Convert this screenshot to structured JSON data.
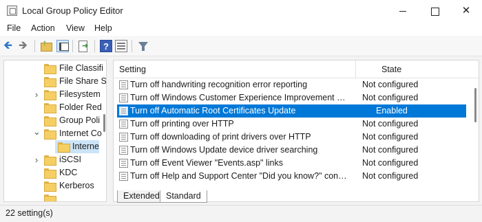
{
  "window": {
    "title": "Local Group Policy Editor"
  },
  "menu": [
    "File",
    "Action",
    "View",
    "Help"
  ],
  "toolbar": {
    "icons": [
      "back-arrow-icon",
      "forward-arrow-icon",
      "up-one-level-icon",
      "show-hide-tree-icon",
      "export-list-icon",
      "help-icon",
      "properties-icon",
      "filter-icon"
    ],
    "help_glyph": "?"
  },
  "tree": {
    "items": [
      {
        "label": "File Classifi",
        "chevron": ""
      },
      {
        "label": "File Share S",
        "chevron": ""
      },
      {
        "label": "Filesystem",
        "chevron": "›"
      },
      {
        "label": "Folder Red",
        "chevron": ""
      },
      {
        "label": "Group Poli",
        "chevron": ""
      },
      {
        "label": "Internet Co",
        "chevron": "⌄"
      },
      {
        "label": "Interne",
        "chevron": ""
      },
      {
        "label": "iSCSI",
        "chevron": "›"
      },
      {
        "label": "KDC",
        "chevron": ""
      },
      {
        "label": "Kerberos",
        "chevron": ""
      }
    ]
  },
  "list": {
    "columns": {
      "setting": "Setting",
      "state": "State"
    },
    "rows": [
      {
        "name": "Turn off handwriting recognition error reporting",
        "state": "Not configured"
      },
      {
        "name": "Turn off Windows Customer Experience Improvement Progr...",
        "state": "Not configured"
      },
      {
        "name": "Turn off Automatic Root Certificates Update",
        "state": "Enabled"
      },
      {
        "name": "Turn off printing over HTTP",
        "state": "Not configured"
      },
      {
        "name": "Turn off downloading of print drivers over HTTP",
        "state": "Not configured"
      },
      {
        "name": "Turn off Windows Update device driver searching",
        "state": "Not configured"
      },
      {
        "name": "Turn off Event Viewer \"Events.asp\" links",
        "state": "Not configured"
      },
      {
        "name": "Turn off Help and Support Center \"Did you know?\" content",
        "state": "Not configured"
      }
    ]
  },
  "tabs": {
    "extended": "Extended",
    "standard": "Standard"
  },
  "status": {
    "text": "22 setting(s)"
  },
  "colors": {
    "selection": "#0078d7",
    "tree_selection": "#cce4f7"
  }
}
